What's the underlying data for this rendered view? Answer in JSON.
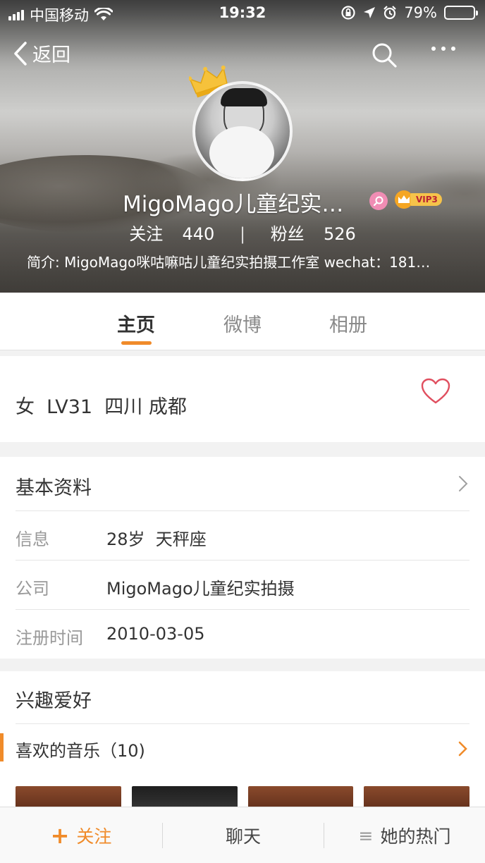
{
  "status_bar": {
    "carrier": "中国移动",
    "time": "19:32",
    "battery": "79%",
    "battery_level": 0.79
  },
  "nav": {
    "back_label": "返回",
    "search_icon": "search-icon",
    "more_icon": "more-dots-icon"
  },
  "profile": {
    "name": "MigoMago儿童纪实…",
    "vip_label": "VIP3",
    "following_label": "关注",
    "following_count": "440",
    "followers_label": "粉丝",
    "followers_count": "526",
    "separator": "|",
    "bio": "简介: MigoMago咪咕嘛咕儿童纪实拍摄工作室 wechat：181…"
  },
  "tabs": [
    {
      "label": "主页",
      "active": true
    },
    {
      "label": "微博",
      "active": false
    },
    {
      "label": "相册",
      "active": false
    }
  ],
  "summary": {
    "line": "女  LV31  四川 成都"
  },
  "basic_info": {
    "title": "基本资料",
    "rows": [
      {
        "label": "信息",
        "value": "28岁  天秤座"
      },
      {
        "label": "公司",
        "value": "MigoMago儿童纪实拍摄"
      },
      {
        "label": "注册时间",
        "value": "2010-03-05"
      }
    ]
  },
  "interests": {
    "title": "兴趣爱好",
    "music_label": "喜欢的音乐（10)"
  },
  "bottom_bar": {
    "follow_plus": "+",
    "follow_label": "关注",
    "chat_label": "聊天",
    "hot_icon": "≡",
    "hot_label": "她的热门"
  },
  "colors": {
    "accent": "#f08b2a",
    "heart": "#e04f5f"
  }
}
